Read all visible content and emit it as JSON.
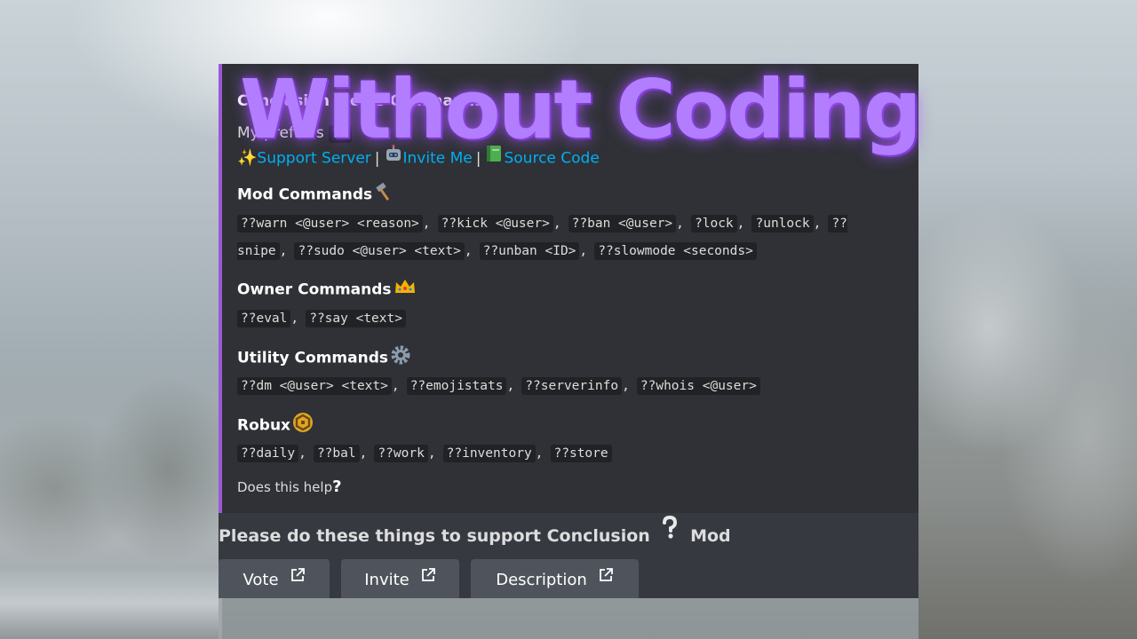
{
  "overlay": {
    "title": "Without Coding"
  },
  "embed": {
    "accent_color": "#9b59d6",
    "author_title": "Conclusion Mod's Commands",
    "prefix_text": "My prefix is ",
    "prefix_value": "??",
    "links": [
      {
        "icon": "sparkles-icon",
        "label": "Support Server"
      },
      {
        "icon": "robot-icon",
        "label": "Invite Me"
      },
      {
        "icon": "book-icon",
        "label": "Source Code"
      }
    ],
    "link_separator": "|",
    "sections": [
      {
        "title": "Mod Commands",
        "icon": "hammer-icon",
        "commands": [
          "??warn <@user> <reason>",
          "??kick <@user>",
          "??ban <@user>",
          "?lock",
          "?unlock",
          "??snipe",
          "??sudo <@user> <text>",
          "??unban <ID>",
          "??slowmode <seconds>"
        ]
      },
      {
        "title": "Owner Commands",
        "icon": "crown-icon",
        "commands": [
          "??eval",
          "??say <text>"
        ]
      },
      {
        "title": "Utility Commands",
        "icon": "gear-icon",
        "commands": [
          "??dm <@user> <text>",
          "??emojistats",
          "??serverinfo",
          "??whois <@user>"
        ]
      },
      {
        "title": "Robux",
        "icon": "robux-coin-icon",
        "commands": [
          "??daily",
          "??bal",
          "??work",
          "??inventory",
          "??store"
        ]
      }
    ],
    "footer": "Does this help",
    "footer_icon": "question-mark-icon"
  },
  "support": {
    "text_before": "Please do these things to support Conclusion",
    "text_after": "Mod"
  },
  "buttons": [
    {
      "label": "Vote"
    },
    {
      "label": "Invite"
    },
    {
      "label": "Description"
    }
  ]
}
